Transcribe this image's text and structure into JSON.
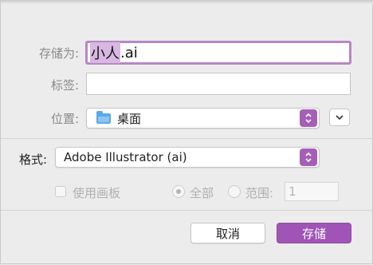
{
  "dialog": {
    "save_as_label": "存储为:",
    "filename_selected": "小人",
    "filename_ext": ".ai",
    "tags_label": "标签:",
    "tags_value": "",
    "where_label": "位置:",
    "where_value": "桌面",
    "where_icon": "folder-icon"
  },
  "options": {
    "format_label": "格式:",
    "format_value": "Adobe Illustrator (ai)",
    "use_artboards_label": "使用画板",
    "use_artboards_checked": false,
    "all_label": "全部",
    "range_label": "范围:",
    "range_value": "1",
    "selected_range_option": "全部"
  },
  "buttons": {
    "cancel": "取消",
    "save": "存储"
  },
  "colors": {
    "accent": "#a055b6",
    "selection": "#d8b8e2",
    "focus_ring": "#b886c6"
  }
}
